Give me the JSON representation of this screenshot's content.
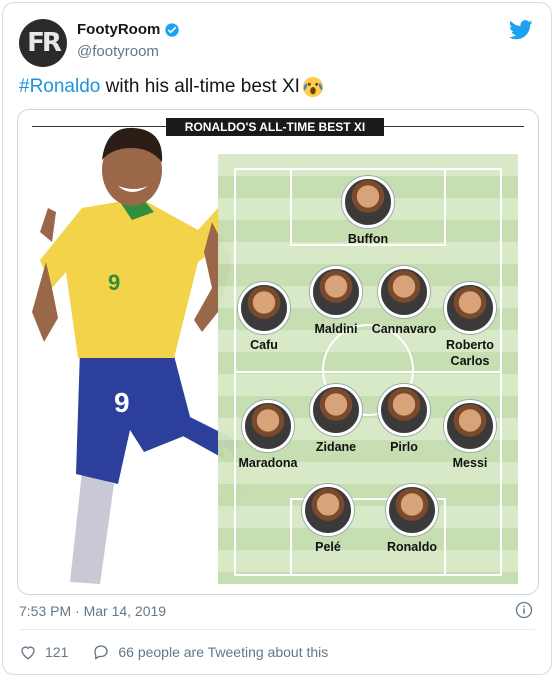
{
  "tweet": {
    "display_name": "FootyRoom",
    "handle": "@footyroom",
    "hashtag": "#Ronaldo",
    "text_rest": " with his all-time best XI",
    "timestamp": "7:53 PM · Mar 14, 2019",
    "likes": "121",
    "tweeting_about": "66 people are Tweeting about this",
    "avatar_text": "FR"
  },
  "graphic": {
    "title": "RONALDO'S ALL-TIME BEST XI",
    "shirt_number": "9",
    "players": [
      {
        "name": "Buffon"
      },
      {
        "name": "Maldini"
      },
      {
        "name": "Cannavaro"
      },
      {
        "name": "Cafu"
      },
      {
        "name": "Roberto Carlos"
      },
      {
        "name": "Zidane"
      },
      {
        "name": "Pirlo"
      },
      {
        "name": "Maradona"
      },
      {
        "name": "Messi"
      },
      {
        "name": "Pelé"
      },
      {
        "name": "Ronaldo"
      }
    ]
  },
  "colors": {
    "accent": "#1da1f2",
    "hashtag": "#1b95e0",
    "muted": "#657786",
    "pitch_light": "#d6e8c5",
    "pitch_dark": "#c4dcae",
    "brazil_yellow": "#f2d34a",
    "brazil_blue": "#2c3f9a"
  },
  "icons": {
    "verified": "verified-badge-icon",
    "bird": "twitter-bird-icon",
    "info": "info-icon",
    "like": "heart-icon",
    "reply": "speech-bubble-icon",
    "emoji": "screaming-face-emoji"
  }
}
